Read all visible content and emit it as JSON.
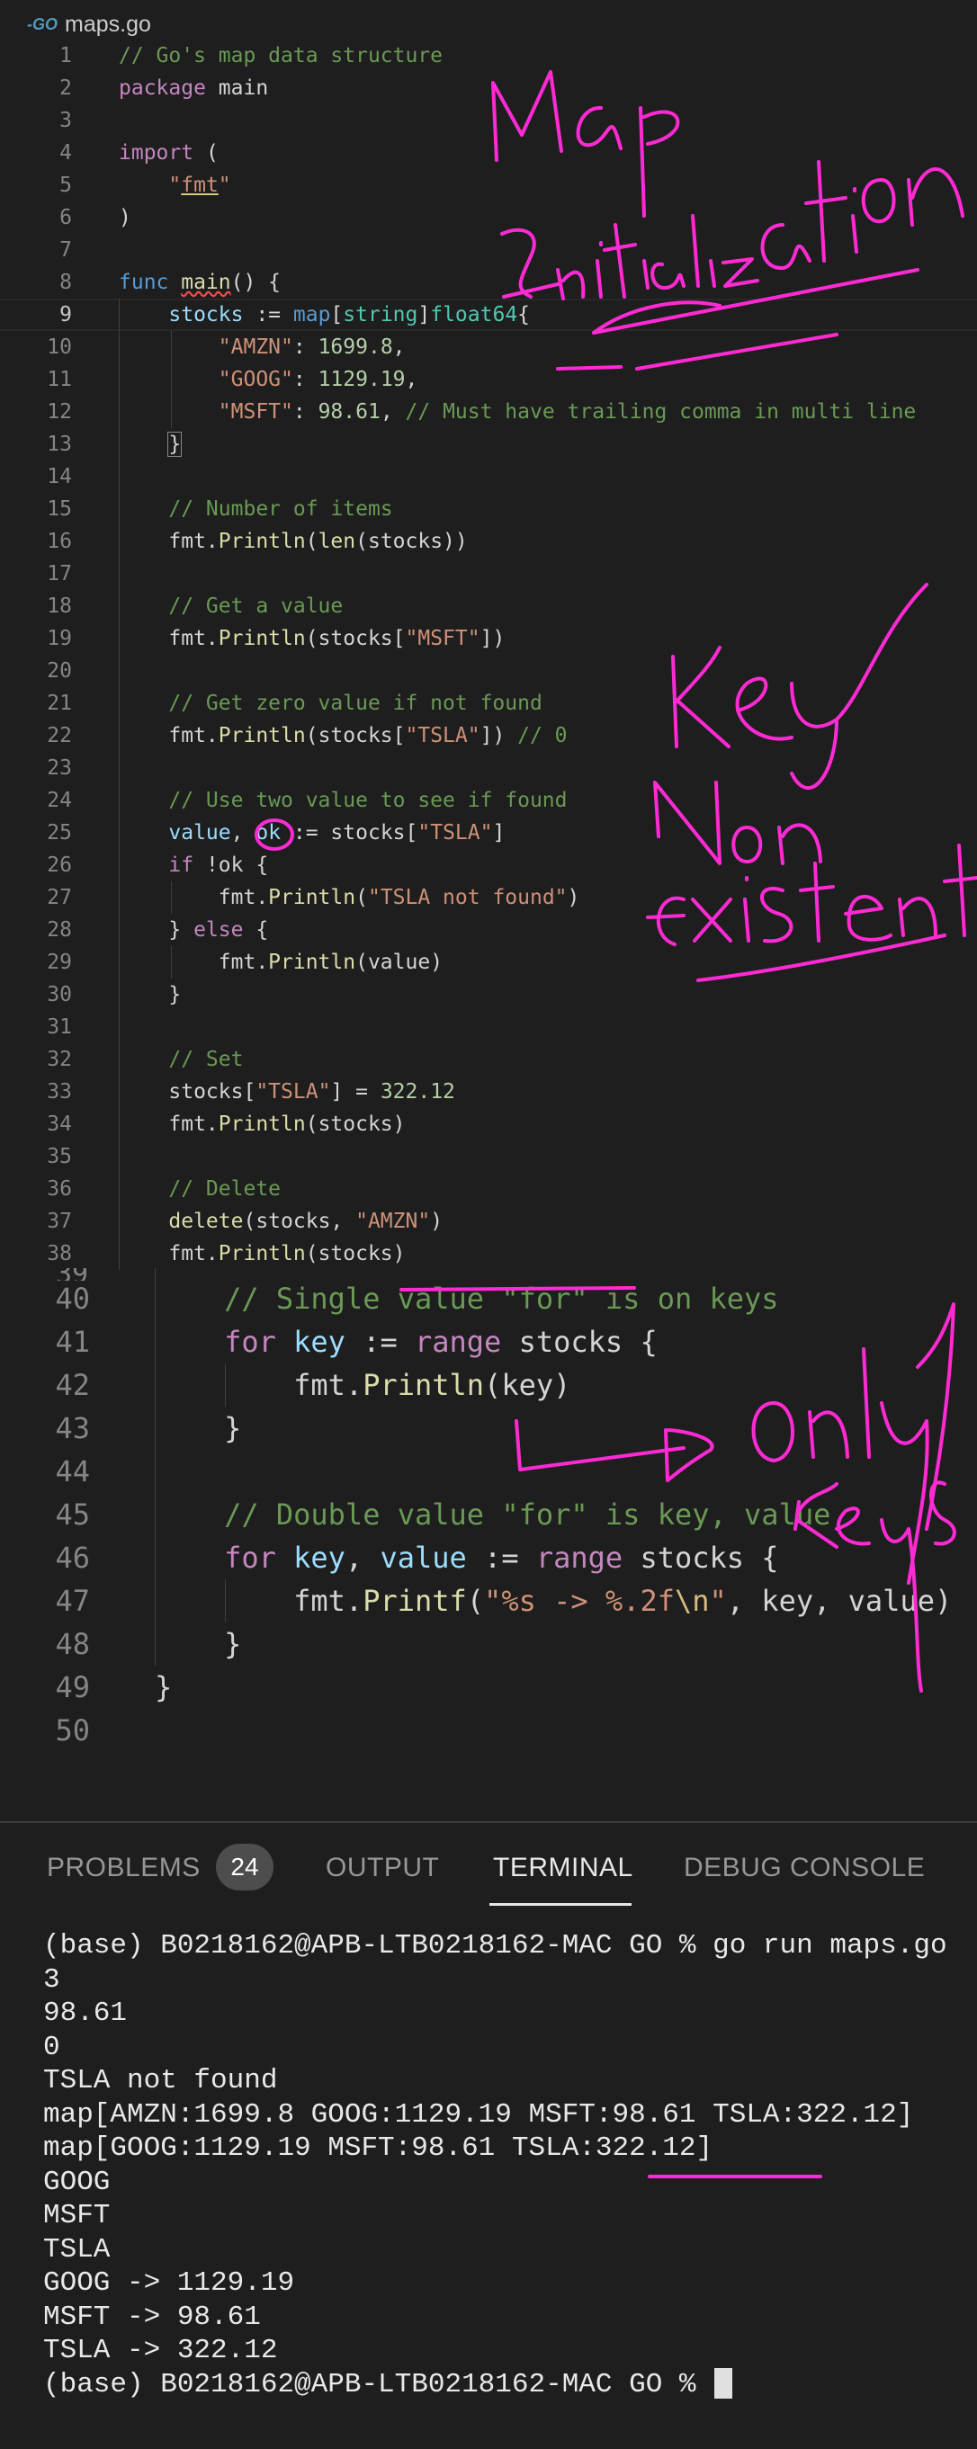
{
  "tab": {
    "icon": "go-file-icon",
    "icon_text": "-GO",
    "filename": "maps.go"
  },
  "editor_top": {
    "lines": [
      {
        "n": "1",
        "html": "<span class=\"cm\">// Go's map data structure</span>"
      },
      {
        "n": "2",
        "html": "<span class=\"kw\">package</span> main"
      },
      {
        "n": "3",
        "html": ""
      },
      {
        "n": "4",
        "html": "<span class=\"kw\">import</span> ("
      },
      {
        "n": "5",
        "html": "    <span class=\"str\">\"<u style=\"text-decoration-color:#d9c97a\">fmt</u>\"</span>"
      },
      {
        "n": "6",
        "html": ")"
      },
      {
        "n": "7",
        "html": ""
      },
      {
        "n": "8",
        "html": "<span class=\"kwb\">func</span> <span class=\"fn\" style=\"text-decoration:underline wavy #f14c4c\">main</span>() {"
      },
      {
        "n": "9",
        "html": "    <span class=\"vr\">stocks</span> := <span class=\"kwb\">map</span>[<span class=\"ty\">string</span>]<span class=\"ty\">float64</span>{"
      },
      {
        "n": "10",
        "html": "        <span class=\"str\">\"AMZN\"</span>: <span class=\"num\">1699.8</span>,"
      },
      {
        "n": "11",
        "html": "        <span class=\"str\">\"GOOG\"</span>: <span class=\"num\">1129.19</span>,"
      },
      {
        "n": "12",
        "html": "        <span class=\"str\">\"MSFT\"</span>: <span class=\"num\">98.61</span>, <span class=\"cm\">// Must have trailing comma in multi line</span>"
      },
      {
        "n": "13",
        "html": "    <span style=\"outline:1px solid #888\">}</span>"
      },
      {
        "n": "14",
        "html": ""
      },
      {
        "n": "15",
        "html": "    <span class=\"cm\">// Number of items</span>"
      },
      {
        "n": "16",
        "html": "    fmt.<span class=\"fn\">Println</span>(<span class=\"fn\">len</span>(stocks))"
      },
      {
        "n": "17",
        "html": ""
      },
      {
        "n": "18",
        "html": "    <span class=\"cm\">// Get a value</span>"
      },
      {
        "n": "19",
        "html": "    fmt.<span class=\"fn\">Println</span>(stocks[<span class=\"str\">\"MSFT\"</span>])"
      },
      {
        "n": "20",
        "html": ""
      },
      {
        "n": "21",
        "html": "    <span class=\"cm\">// Get zero value if not found</span>"
      },
      {
        "n": "22",
        "html": "    fmt.<span class=\"fn\">Println</span>(stocks[<span class=\"str\">\"TSLA\"</span>]) <span class=\"cm\">// 0</span>"
      },
      {
        "n": "23",
        "html": ""
      },
      {
        "n": "24",
        "html": "    <span class=\"cm\">// Use two value to see if found</span>"
      },
      {
        "n": "25",
        "html": "    <span class=\"vr\">value</span>, <span class=\"vr\">ok</span> := stocks[<span class=\"str\">\"TSLA\"</span>]"
      },
      {
        "n": "26",
        "html": "    <span class=\"kw\">if</span> !ok {"
      },
      {
        "n": "27",
        "html": "        fmt.<span class=\"fn\">Println</span>(<span class=\"str\">\"TSLA not found\"</span>)"
      },
      {
        "n": "28",
        "html": "    } <span class=\"kw\">else</span> {"
      },
      {
        "n": "29",
        "html": "        fmt.<span class=\"fn\">Println</span>(value)"
      },
      {
        "n": "30",
        "html": "    }"
      },
      {
        "n": "31",
        "html": ""
      },
      {
        "n": "32",
        "html": "    <span class=\"cm\">// Set</span>"
      },
      {
        "n": "33",
        "html": "    stocks[<span class=\"str\">\"TSLA\"</span>] = <span class=\"num\">322.12</span>"
      },
      {
        "n": "34",
        "html": "    fmt.<span class=\"fn\">Println</span>(stocks)"
      },
      {
        "n": "35",
        "html": ""
      },
      {
        "n": "36",
        "html": "    <span class=\"cm\">// Delete</span>"
      },
      {
        "n": "37",
        "html": "    <span class=\"fn\">delete</span>(stocks, <span class=\"str\">\"AMZN\"</span>)"
      },
      {
        "n": "38",
        "html": "    fmt.<span class=\"fn\">Println</span>(stocks)"
      }
    ]
  },
  "editor_bottom": {
    "lines": [
      {
        "n": "40",
        "html": "    <span class=\"cm\">// Single value \"for\" is on keys</span>"
      },
      {
        "n": "41",
        "html": "    <span class=\"kw\">for</span> <span class=\"vr\">key</span> := <span class=\"kw\">range</span> stocks {"
      },
      {
        "n": "42",
        "html": "        fmt.<span class=\"fn\">Println</span>(key)"
      },
      {
        "n": "43",
        "html": "    }"
      },
      {
        "n": "44",
        "html": ""
      },
      {
        "n": "45",
        "html": "    <span class=\"cm\">// Double value \"for\" is key, value</span>"
      },
      {
        "n": "46",
        "html": "    <span class=\"kw\">for</span> <span class=\"vr\">key</span>, <span class=\"vr\">value</span> := <span class=\"kw\">range</span> stocks {"
      },
      {
        "n": "47",
        "html": "        fmt.<span class=\"fn\">Printf</span>(<span class=\"str\">\"%s -> %.2f<span class=\"esc\">\\n</span>\"</span>, key, value)"
      },
      {
        "n": "48",
        "html": "    }"
      },
      {
        "n": "49",
        "html": "}"
      },
      {
        "n": "50",
        "html": ""
      }
    ]
  },
  "panel": {
    "tabs": [
      {
        "label": "PROBLEMS",
        "active": false
      },
      {
        "label": "OUTPUT",
        "active": false
      },
      {
        "label": "TERMINAL",
        "active": true
      },
      {
        "label": "DEBUG CONSOLE",
        "active": false
      }
    ],
    "problems_count": "24"
  },
  "terminal": {
    "lines": [
      "(base) B0218162@APB-LTB0218162-MAC GO % go run maps.go",
      "3",
      "98.61",
      "0",
      "TSLA not found",
      "map[AMZN:1699.8 GOOG:1129.19 MSFT:98.61 TSLA:322.12]",
      "map[GOOG:1129.19 MSFT:98.61 TSLA:322.12]",
      "GOOG",
      "MSFT",
      "TSLA",
      "GOOG -> 1129.19",
      "MSFT -> 98.61",
      "TSLA -> 322.12"
    ],
    "prompt": "(base) B0218162@APB-LTB0218162-MAC GO % "
  },
  "annotations": {
    "color": "#ff2ad4",
    "notes": [
      "Map Initialization",
      "Key Non existent",
      "Only Keys"
    ]
  },
  "colors": {
    "background": "#1e1e1e",
    "comment": "#6a9955",
    "keyword": "#c586c0",
    "string": "#ce9178",
    "number": "#b5cea8",
    "annotation": "#ff2ad4"
  }
}
